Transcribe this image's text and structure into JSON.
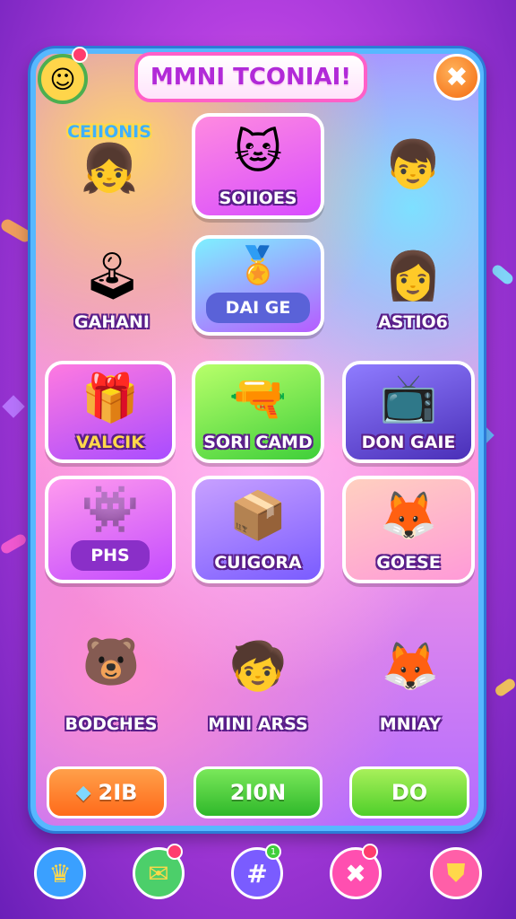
{
  "header": {
    "title": "MMNI TCONIAI!",
    "close_symbol": "✖"
  },
  "tiles": [
    {
      "label": "CEIIONIS",
      "icon": "girl-waving-icon"
    },
    {
      "label": "SOIIOES",
      "icon": "cat-girl-icon"
    },
    {
      "label": "",
      "icon": "boy-with-ice-cream-icon"
    },
    {
      "label": "GAHANI",
      "icon": "arcade-machine-icon"
    },
    {
      "label": "DAI GE",
      "icon": "gold-badge-icon"
    },
    {
      "label": "ASTIO6",
      "icon": "red-haired-girl-icon"
    },
    {
      "label": "VALCIK",
      "icon": "gift-box-icon"
    },
    {
      "label": "SORI CAMD",
      "icon": "pink-blaster-icon"
    },
    {
      "label": "DON GAIE",
      "icon": "tv-screen-icon"
    },
    {
      "label": "PHS",
      "icon": "blue-creature-icon"
    },
    {
      "label": "CUIGORA",
      "icon": "kids-sharing-crate-icon"
    },
    {
      "label": "GOESE",
      "icon": "fox-girl-treasure-icon"
    },
    {
      "label": "BODCHES",
      "icon": "bear-with-staff-icon"
    },
    {
      "label": "MINI ARSS",
      "icon": "boy-with-party-hat-icon"
    },
    {
      "label": "MNIAY",
      "icon": "fox-character-icon"
    }
  ],
  "bottom_buttons": [
    {
      "label": "2IB",
      "icon": "gem-icon",
      "color": "#ff7a1a"
    },
    {
      "label": "2I0N",
      "icon": "",
      "color": "#3fc93a"
    },
    {
      "label": "DO",
      "icon": "",
      "color": "#6fd93a"
    }
  ],
  "nav": [
    {
      "icon": "trophy-icon",
      "symbol": "♛",
      "color": "#3aa0ff"
    },
    {
      "icon": "mail-icon",
      "symbol": "✉",
      "color": "#4ccf6a",
      "badge": ""
    },
    {
      "icon": "grid-icon",
      "symbol": "#",
      "color": "#7a5cff",
      "badge": "1"
    },
    {
      "icon": "cross-icon",
      "symbol": "✖",
      "color": "#ff4fb0",
      "badge": ""
    },
    {
      "icon": "shield-icon",
      "symbol": "⛊",
      "color": "#ff5fa8"
    }
  ]
}
